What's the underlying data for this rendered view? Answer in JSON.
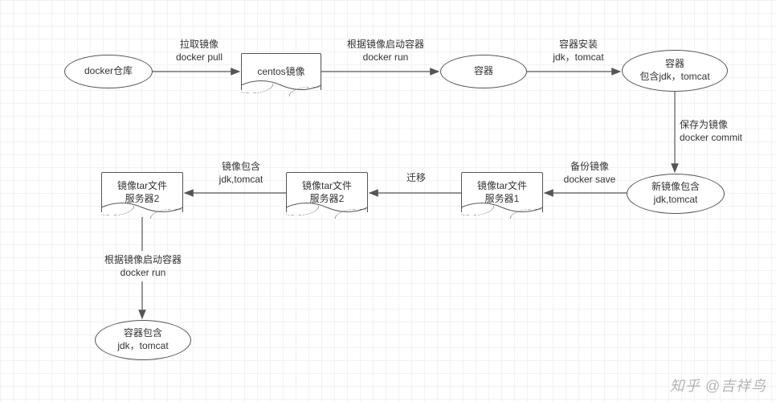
{
  "chart_data": {
    "type": "flowchart",
    "nodes": [
      {
        "id": "n1",
        "shape": "ellipse",
        "label": "docker仓库"
      },
      {
        "id": "n2",
        "shape": "document",
        "label": "centos镜像"
      },
      {
        "id": "n3",
        "shape": "ellipse",
        "label": "容器"
      },
      {
        "id": "n4",
        "shape": "ellipse",
        "label_line1": "容器",
        "label_line2": "包含jdk，tomcat"
      },
      {
        "id": "n5",
        "shape": "ellipse",
        "label_line1": "新镜像包含",
        "label_line2": "jdk,tomcat"
      },
      {
        "id": "n6",
        "shape": "document",
        "label_line1": "镜像tar文件",
        "label_line2": "服务器1"
      },
      {
        "id": "n7",
        "shape": "document",
        "label_line1": "镜像tar文件",
        "label_line2": "服务器2"
      },
      {
        "id": "n8",
        "shape": "document",
        "label_line1": "镜像tar文件",
        "label_line2": "服务器2"
      },
      {
        "id": "n9",
        "shape": "ellipse",
        "label_line1": "容器包含",
        "label_line2": "jdk，tomcat"
      }
    ],
    "edges": [
      {
        "from": "n1",
        "to": "n2",
        "label_line1": "拉取镜像",
        "label_line2": "docker pull"
      },
      {
        "from": "n2",
        "to": "n3",
        "label_line1": "根据镜像启动容器",
        "label_line2": "docker run"
      },
      {
        "from": "n3",
        "to": "n4",
        "label_line1": "容器安装",
        "label_line2": "jdk，tomcat"
      },
      {
        "from": "n4",
        "to": "n5",
        "label_line1": "保存为镜像",
        "label_line2": "docker commit"
      },
      {
        "from": "n5",
        "to": "n6",
        "label_line1": "备份镜像",
        "label_line2": "docker save"
      },
      {
        "from": "n6",
        "to": "n7",
        "label_line1": "迁移"
      },
      {
        "from": "n7",
        "to": "n8",
        "label_line1": "镜像包含",
        "label_line2": "jdk,tomcat"
      },
      {
        "from": "n8",
        "to": "n9",
        "label_line1": "根据镜像启动容器",
        "label_line2": "docker run"
      }
    ]
  },
  "watermark": "知乎 @吉祥鸟"
}
